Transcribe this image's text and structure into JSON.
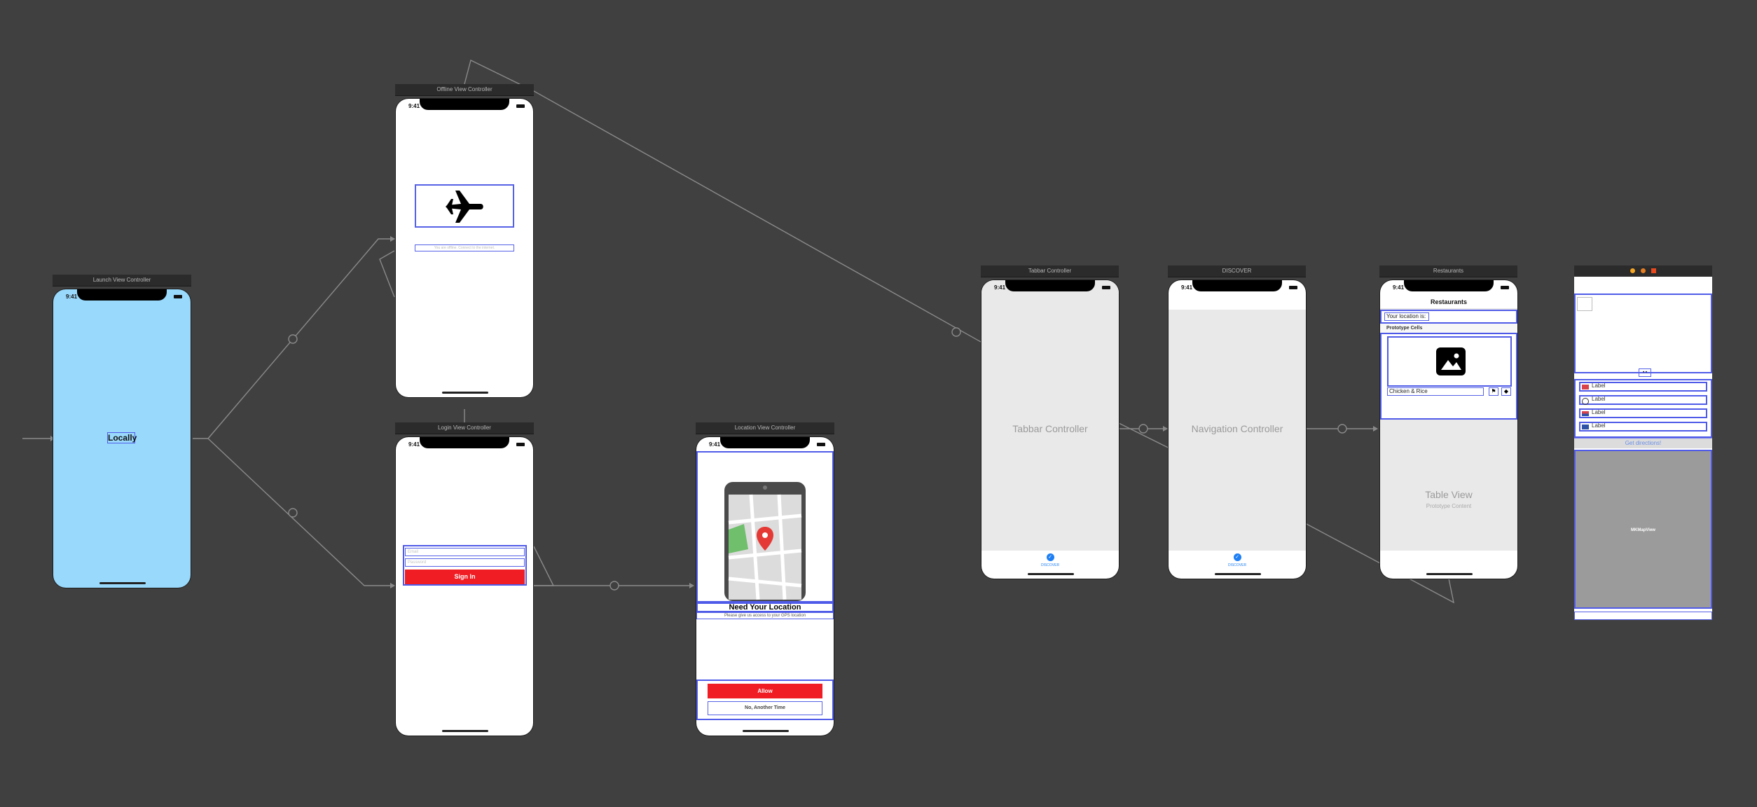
{
  "canvas": {
    "background": "#404040",
    "accent_blue": "#4f5be8",
    "red_button": "#f01e24",
    "launch_bg": "#99d9fc"
  },
  "status_time": "9:41",
  "scenes": {
    "launch": {
      "title": "Launch View Controller",
      "app_label": "Locally"
    },
    "offline": {
      "title": "Offline View Controller",
      "icon": "airplane-icon",
      "message": "You are offline. Connect to the internet."
    },
    "login": {
      "title": "Login View Controller",
      "email_placeholder": "Email",
      "password_placeholder": "Password",
      "signin_label": "Sign In"
    },
    "location": {
      "title": "Location View Controller",
      "heading": "Need Your Location",
      "subtitle": "Please give us access to your GPS location",
      "allow_label": "Allow",
      "decline_label": "No, Another Time"
    },
    "tabbar": {
      "title": "Tabbar Controller",
      "placeholder": "Tabbar Controller",
      "tab_label": "DISCOVER"
    },
    "discover": {
      "title": "DISCOVER",
      "placeholder": "Navigation Controller",
      "tab_label": "DISCOVER"
    },
    "restaurants": {
      "title": "Restaurants",
      "nav_title": "Restaurants",
      "location_label": "Your location is:",
      "prototype_header": "Prototype Cells",
      "cell_title": "Chicken & Rice",
      "table_placeholder": "Table View",
      "table_sub": "Prototype Content"
    },
    "detail": {
      "labels": [
        "Label",
        "Label",
        "Label",
        "Label"
      ],
      "directions_label": "Get directions!",
      "map_label": "MKMapView"
    }
  }
}
